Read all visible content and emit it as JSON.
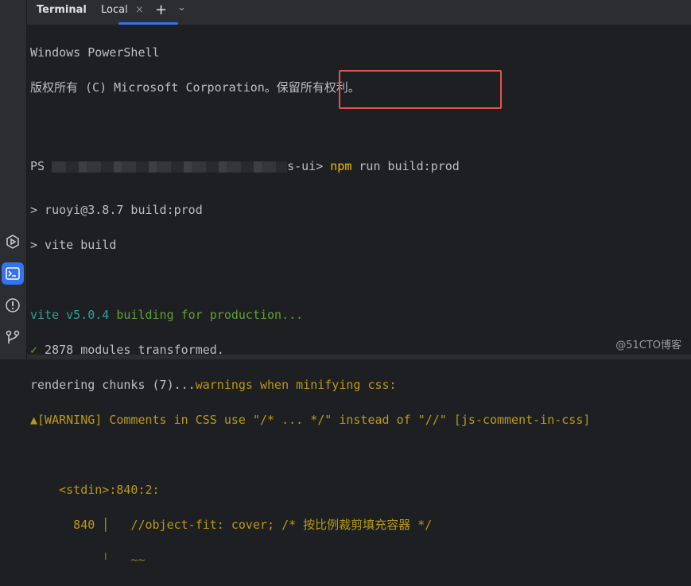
{
  "tabs": {
    "title": "Terminal",
    "local": "Local",
    "close": "×",
    "add": "+",
    "more": "⌄"
  },
  "prompt": {
    "ps": "PS",
    "path_suffix": "s-ui>",
    "command_kw": "npm",
    "command_rest": " run build:prod"
  },
  "lines": {
    "l1": "Windows PowerShell",
    "l2": "版权所有 (C) Microsoft Corporation。保留所有权利。",
    "l4": "> ruoyi@3.8.7 build:prod",
    "l5": "> vite build",
    "vite": "vite v5.0.4",
    "building": " building for production...",
    "check": "✓",
    "modules": " 2878 modules transformed.",
    "rendering": "rendering chunks (7)...",
    "warnings": "warnings when minifying css:",
    "warn_icon": "▲",
    "warning": "[WARNING] Comments in CSS use \"/* ... */\" instead of \"//\" [js-comment-in-css]",
    "stdin": "    <stdin>:840:2:",
    "lineno": "      840 │   ",
    "code": "//object-fit: cover; /* 按比例裁剪填充容器 */",
    "caret": "          ╵   ~~"
  },
  "watermark": "@51CTO博客"
}
